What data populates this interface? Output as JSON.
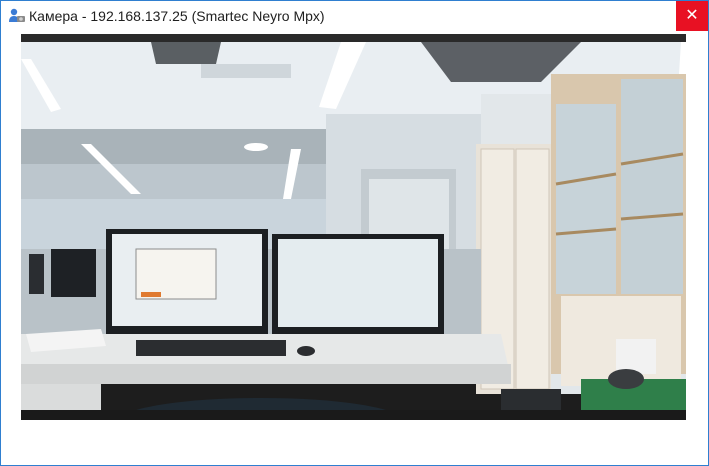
{
  "window": {
    "title": "Камера - 192.168.137.25 (Smartec Neyro Mpx)",
    "app_icon": "camera-user-icon",
    "close_glyph": "✕"
  },
  "colors": {
    "border": "#2f7fd0",
    "close_button": "#e81123"
  },
  "video_feed": {
    "description_icon": "camera-live-view"
  }
}
